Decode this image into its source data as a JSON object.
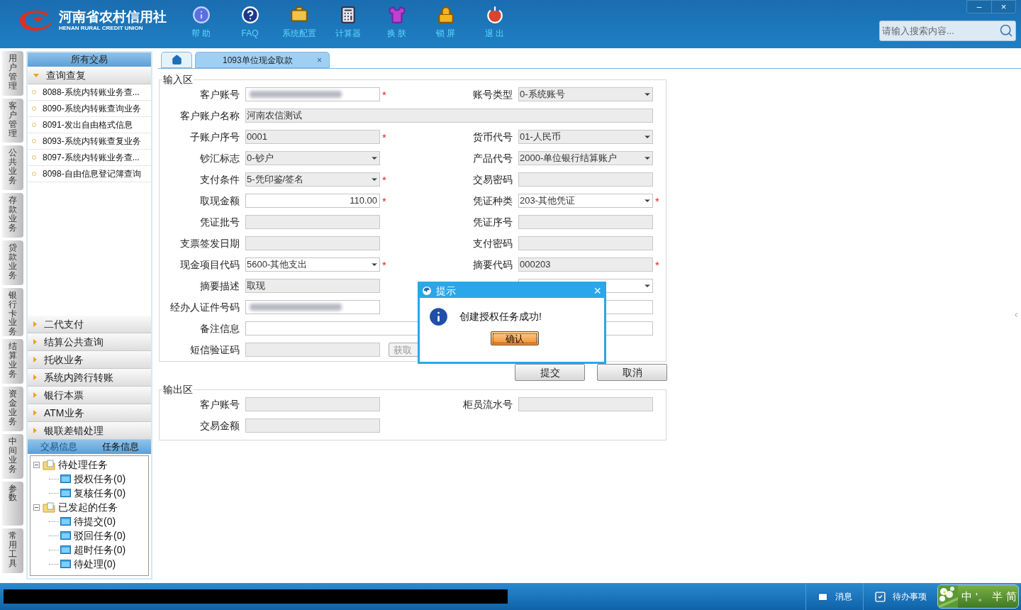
{
  "header": {
    "logo_cn": "河南省农村信用社",
    "logo_en": "HENAN RURAL CREDIT UNION",
    "tools": [
      {
        "kind": "info",
        "label": "帮 助"
      },
      {
        "kind": "faq",
        "label": "FAQ"
      },
      {
        "kind": "config",
        "label": "系统配置"
      },
      {
        "kind": "calculator",
        "label": "计算器"
      },
      {
        "kind": "skin",
        "label": "换 肤"
      },
      {
        "kind": "lock",
        "label": "锁 屏"
      },
      {
        "kind": "exit",
        "label": "退 出"
      }
    ],
    "search": {
      "placeholder": "请输入搜索内容..."
    },
    "window_buttons": [
      "–",
      "×"
    ]
  },
  "side_tabs": [
    "用户管理",
    "客户管理",
    "公共业务",
    "存款业务",
    "贷款业务",
    "银行卡业务",
    "结算业务",
    "资金业务",
    "中间业务",
    "参数",
    "常用工具"
  ],
  "sidebar": {
    "title": "所有交易",
    "groups": [
      {
        "label": "查询查复",
        "expanded": true,
        "items": [
          "8088-系统内转账业务查...",
          "8090-系统内转账查询业务",
          "8091-发出自由格式信息",
          "8093-系统内转账查复业务",
          "8097-系统内转账业务查...",
          "8098-自由信息登记簿查询"
        ]
      },
      {
        "label": "二代支付",
        "expanded": false
      },
      {
        "label": "结算公共查询",
        "expanded": false
      },
      {
        "label": "托收业务",
        "expanded": false
      },
      {
        "label": "系统内跨行转账",
        "expanded": false
      },
      {
        "label": "银行本票",
        "expanded": false
      },
      {
        "label": "ATM业务",
        "expanded": false
      },
      {
        "label": "银联差错处理",
        "expanded": false
      }
    ],
    "info_tabs": [
      {
        "label": "交易信息",
        "selected": false
      },
      {
        "label": "任务信息",
        "selected": true
      }
    ],
    "tree": [
      {
        "label": "待处理任务",
        "expanded": true,
        "children": [
          {
            "label": "授权任务(0)"
          },
          {
            "label": "复核任务(0)"
          }
        ]
      },
      {
        "label": "已发起的任务",
        "expanded": true,
        "children": [
          {
            "label": "待提交(0)"
          },
          {
            "label": "驳回任务(0)"
          },
          {
            "label": "超时任务(0)"
          },
          {
            "label": "待处理(0)"
          }
        ]
      }
    ]
  },
  "tabs": [
    {
      "kind": "home",
      "selected": false
    },
    {
      "kind": "page",
      "label": "1093单位现金取款",
      "close": "×",
      "selected": true
    }
  ],
  "input_area": {
    "title": "输入区",
    "rows": [
      {
        "fields": [
          {
            "label": "客户账号",
            "kind": "text",
            "editable": true,
            "asterisk": "*",
            "blurred": true
          },
          {
            "label": "账号类型",
            "kind": "select",
            "value": "0-系统账号",
            "editable": false
          }
        ]
      },
      {
        "fields": [
          {
            "label": "客户账户名称",
            "kind": "text",
            "value": "河南农信测试",
            "editable": false,
            "wide": true
          }
        ]
      },
      {
        "fields": [
          {
            "label": "子账户序号",
            "kind": "text",
            "value": "0001",
            "editable": false,
            "asterisk": "*"
          },
          {
            "label": "货币代号",
            "kind": "select",
            "value": "01-人民币",
            "editable": false
          }
        ]
      },
      {
        "fields": [
          {
            "label": "钞汇标志",
            "kind": "select",
            "value": "0-钞户",
            "editable": false
          },
          {
            "label": "产品代号",
            "kind": "select",
            "value": "2000-单位银行结算账户",
            "editable": false
          }
        ]
      },
      {
        "fields": [
          {
            "label": "支付条件",
            "kind": "select",
            "value": "5-凭印鉴/签名",
            "editable": false,
            "asterisk": "*"
          },
          {
            "label": "交易密码",
            "kind": "text",
            "editable": false
          }
        ]
      },
      {
        "fields": [
          {
            "label": "取现金额",
            "kind": "amount",
            "value": "110.00",
            "editable": true,
            "asterisk": "*"
          },
          {
            "label": "凭证种类",
            "kind": "select",
            "value": "203-其他凭证",
            "editable": true,
            "asterisk": "*"
          }
        ]
      },
      {
        "fields": [
          {
            "label": "凭证批号",
            "kind": "text",
            "editable": false
          },
          {
            "label": "凭证序号",
            "kind": "text",
            "editable": false
          }
        ]
      },
      {
        "fields": [
          {
            "label": "支票签发日期",
            "kind": "text",
            "editable": false
          },
          {
            "label": "支付密码",
            "kind": "text",
            "editable": false
          }
        ]
      },
      {
        "fields": [
          {
            "label": "现金项目代码",
            "kind": "select",
            "value": "5600-其他支出",
            "editable": true,
            "asterisk": "*"
          },
          {
            "label": "摘要代码",
            "kind": "text",
            "value": "000203",
            "editable": false,
            "asterisk": "*"
          }
        ]
      },
      {
        "fields": [
          {
            "label": "摘要描述",
            "kind": "text",
            "value": "取现",
            "editable": false
          },
          {
            "kind": "select",
            "editable": true
          }
        ]
      },
      {
        "fields": [
          {
            "label": "经办人证件号码",
            "kind": "text",
            "editable": true,
            "blurred": true
          },
          {
            "kind": "text",
            "editable": true
          }
        ]
      },
      {
        "fields": [
          {
            "label": "备注信息",
            "kind": "text",
            "editable": true,
            "wide": true
          }
        ]
      },
      {
        "fields": [
          {
            "label": "短信验证码",
            "kind": "text",
            "editable": false,
            "button": "获取"
          }
        ]
      }
    ]
  },
  "actions": [
    "提交",
    "取消"
  ],
  "output_area": {
    "title": "输出区",
    "rows": [
      {
        "fields": [
          {
            "label": "客户账号",
            "kind": "text",
            "editable": false
          },
          {
            "label": "柜员流水号",
            "kind": "text",
            "editable": false
          }
        ]
      },
      {
        "fields": [
          {
            "label": "交易金额",
            "kind": "text",
            "editable": false
          }
        ]
      }
    ]
  },
  "dialog": {
    "title": "提示",
    "close": "×",
    "message": "创建授权任务成功!",
    "button": "确认"
  },
  "status_bar": {
    "redacted": true,
    "items": [
      {
        "kind": "mail",
        "label": "消息"
      },
      {
        "kind": "todo",
        "label": "待办事项"
      }
    ],
    "ime": [
      "中",
      "'。",
      "半",
      "简"
    ]
  }
}
